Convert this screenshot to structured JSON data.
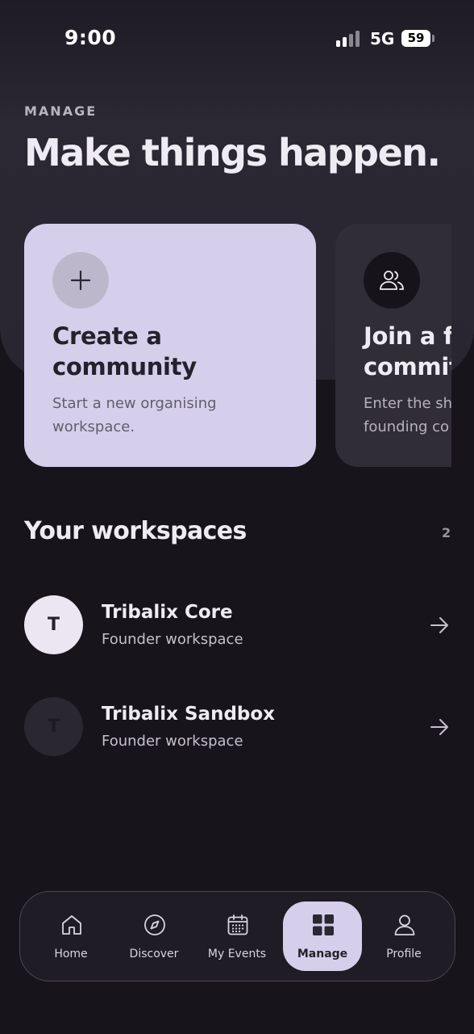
{
  "status_bar": {
    "time": "9:00",
    "network": "5G",
    "battery": "59"
  },
  "header": {
    "eyebrow": "MANAGE",
    "headline": "Make things happen."
  },
  "cards": {
    "create": {
      "icon": "plus-icon",
      "title_line1": "Create a",
      "title_line2": "community",
      "desc_line1": "Start a new organising",
      "desc_line2": "workspace."
    },
    "join": {
      "icon": "people-icon",
      "title_line1": "Join a f",
      "title_line2": "commit",
      "desc_line1": "Enter the sh",
      "desc_line2": "founding co"
    }
  },
  "workspaces": {
    "title": "Your workspaces",
    "count": "2",
    "items": [
      {
        "initial": "T",
        "name": "Tribalix Core",
        "subtitle": "Founder workspace"
      },
      {
        "initial": "T",
        "name": "Tribalix Sandbox",
        "subtitle": "Founder workspace"
      }
    ]
  },
  "tabbar": {
    "items": [
      {
        "label": "Home",
        "icon": "home-icon"
      },
      {
        "label": "Discover",
        "icon": "compass-icon"
      },
      {
        "label": "My Events",
        "icon": "calendar-icon"
      },
      {
        "label": "Manage",
        "icon": "grid-icon",
        "active": true
      },
      {
        "label": "Profile",
        "icon": "person-icon"
      }
    ]
  },
  "colors": {
    "background": "#17141c",
    "accent": "#d6cfeb",
    "surface": "#312d37",
    "text": "#efebf3"
  }
}
